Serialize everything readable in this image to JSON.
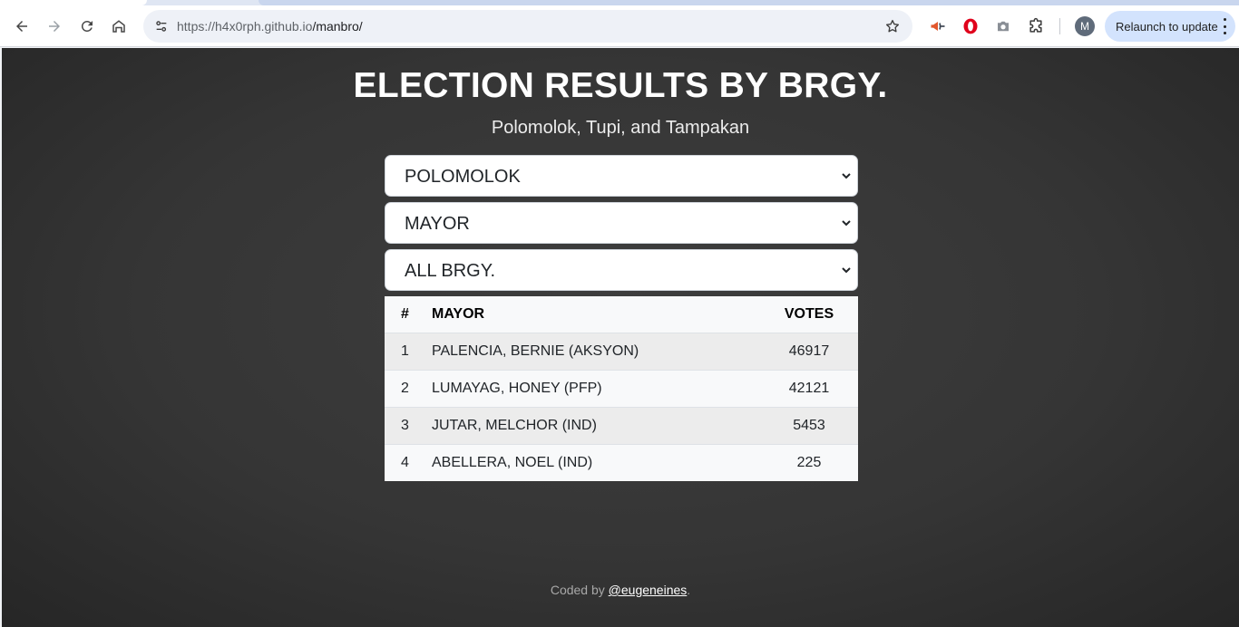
{
  "browser": {
    "url_host": "https://h4x0rph.github.io",
    "url_path": "/manbro/",
    "relaunch_label": "Relaunch to update",
    "profile_initial": "M"
  },
  "page": {
    "title": "ELECTION RESULTS BY BRGY.",
    "subtitle": "Polomolok, Tupi, and Tampakan",
    "selects": {
      "municipality": "POLOMOLOK",
      "position": "MAYOR",
      "barangay": "ALL BRGY."
    },
    "table": {
      "headers": {
        "num": "#",
        "name": "MAYOR",
        "votes": "VOTES"
      },
      "rows": [
        {
          "num": "1",
          "name": "PALENCIA, BERNIE (AKSYON)",
          "votes": "46917"
        },
        {
          "num": "2",
          "name": "LUMAYAG, HONEY (PFP)",
          "votes": "42121"
        },
        {
          "num": "3",
          "name": "JUTAR, MELCHOR (IND)",
          "votes": "5453"
        },
        {
          "num": "4",
          "name": "ABELLERA, NOEL (IND)",
          "votes": "225"
        }
      ]
    },
    "footer": {
      "prefix": "Coded by",
      "link_text": "@eugeneines",
      "suffix": "."
    }
  },
  "icons": {
    "back": "arrow-left-icon",
    "forward": "arrow-right-icon",
    "reload": "reload-icon",
    "home": "home-icon",
    "site_info": "tune-icon",
    "bookmark": "star-icon",
    "ext1": "megaphone-icon",
    "ext2": "opera-icon",
    "ext3": "camera-icon",
    "extensions": "puzzle-icon"
  }
}
